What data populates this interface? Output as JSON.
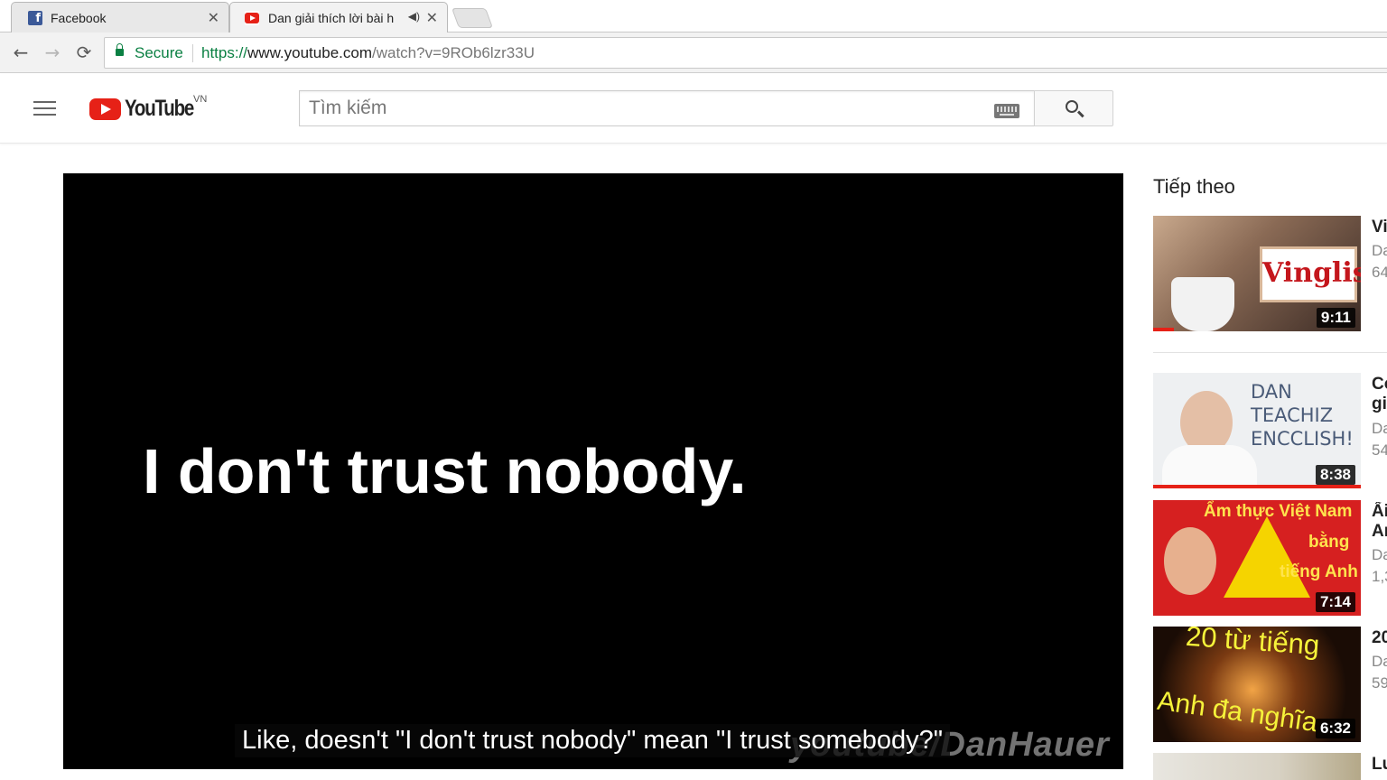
{
  "browser": {
    "tabs": [
      {
        "title": "Facebook",
        "active": false
      },
      {
        "title": "Dan giải thích lời bài h",
        "active": true,
        "muted": true
      }
    ],
    "nav": {
      "back": "←",
      "forward": "→",
      "reload": "⟳"
    },
    "secure_label": "Secure",
    "url_scheme": "https://",
    "url_host": "www.youtube.com",
    "url_path": "/watch?v=9ROb6lzr33U"
  },
  "youtube": {
    "logo_text": "YouTube",
    "region": "VN",
    "search_placeholder": "Tìm kiếm",
    "brand_color": "#e62117"
  },
  "player": {
    "frame_text": "I don't trust nobody.",
    "caption": "Like, doesn't \"I don't trust nobody\" mean \"I trust somebody?\"",
    "watermark": "youtube/DanHauer"
  },
  "up_next": {
    "heading": "Tiếp theo",
    "items": [
      {
        "title": "Vi",
        "channel": "Da",
        "views": "64",
        "duration": "9:11",
        "thumb_label": "Vinglish",
        "progress": 0.1
      },
      {
        "title": "Co gi",
        "channel": "Da",
        "views": "54",
        "duration": "8:38",
        "thumb_label": "DAN TEACHIZ ENCCLISH!"
      },
      {
        "title": "Ẩi An",
        "channel": "Da",
        "views": "1,3",
        "duration": "7:14",
        "thumb_label_1": "Ẩm thực Việt Nam",
        "thumb_label_2": "bằng",
        "thumb_label_3": "tiếng Anh"
      },
      {
        "title": "20",
        "channel": "Da",
        "views": "59",
        "duration": "6:32",
        "thumb_label_1": "20 từ tiếng",
        "thumb_label_2": "Anh đa nghĩa"
      },
      {
        "title": "Lu"
      }
    ]
  }
}
